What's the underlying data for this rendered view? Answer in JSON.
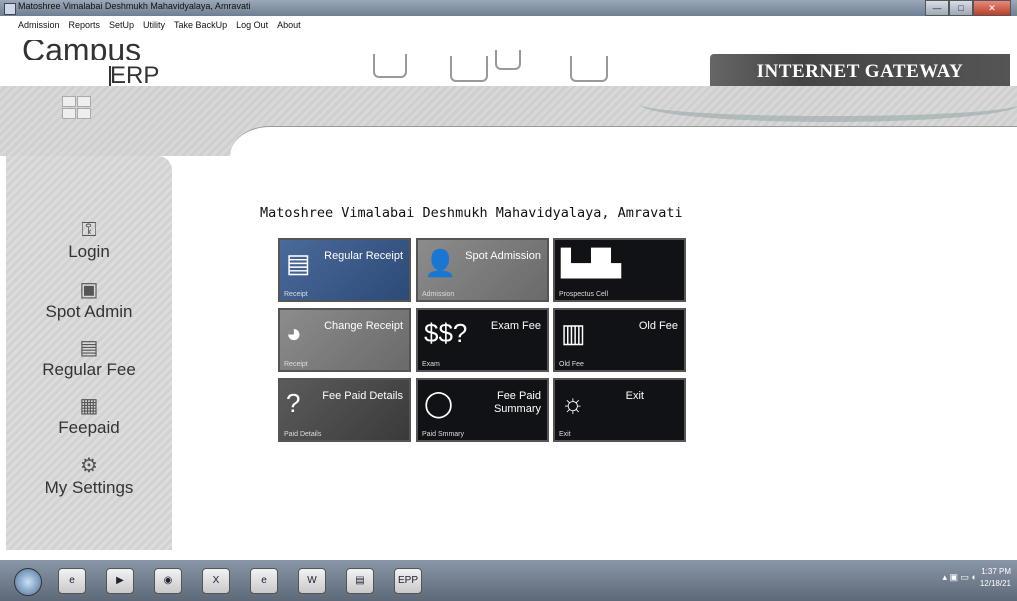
{
  "window": {
    "title": "Matoshree Vimalabai Deshmukh Mahavidyalaya, Amravati",
    "min": "—",
    "max": "□",
    "close": "✕"
  },
  "menu": [
    "Admission",
    "Reports",
    "SetUp",
    "Utility",
    "Take BackUp",
    "Log Out",
    "About"
  ],
  "logo": {
    "line1": "Campus",
    "line2": "ERP"
  },
  "gateway": "INTERNET GATEWAY",
  "sidebar": [
    {
      "label": "Login",
      "icon": "key-icon"
    },
    {
      "label": "Spot Admin",
      "icon": "person-card-icon"
    },
    {
      "label": "Regular Fee",
      "icon": "document-icon"
    },
    {
      "label": "Feepaid",
      "icon": "cards-icon"
    },
    {
      "label": "My Settings",
      "icon": "settings-people-icon"
    }
  ],
  "college_name": "Matoshree Vimalabai Deshmukh Mahavidyalaya, Amravati",
  "tiles": [
    {
      "title": "Regular Receipt",
      "sub": "Receipt",
      "icon": "receipt-icon"
    },
    {
      "title": "Spot Admission",
      "sub": "Admission",
      "icon": "person-icon"
    },
    {
      "title": "",
      "sub": "Prospectus Cell",
      "icon": "buildings-icon"
    },
    {
      "title": "Change Receipt",
      "sub": "Receipt",
      "icon": "pie-icon"
    },
    {
      "title": "Exam Fee",
      "sub": "Exam",
      "icon": "dollar-icon",
      "glyph": "$$?"
    },
    {
      "title": "Old Fee",
      "sub": "Old Fee",
      "icon": "book-icon"
    },
    {
      "title": "Fee Paid Details",
      "sub": "Paid Details",
      "icon": "question-icon",
      "glyph": "?"
    },
    {
      "title": "Fee Paid Summary",
      "sub": "Paid Smmary",
      "icon": "moon-icon"
    },
    {
      "title": "Exit",
      "sub": "Exit",
      "icon": "sun-icon"
    }
  ],
  "taskbar": {
    "app_label": "EPP"
  },
  "clock": {
    "time": "1:37 PM",
    "date": "12/18/21"
  }
}
